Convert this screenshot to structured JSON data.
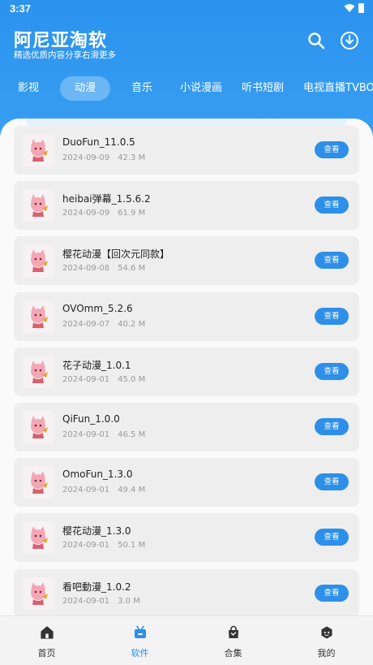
{
  "status_bar": {
    "time": "3:37"
  },
  "header": {
    "title": "阿尼亚淘软",
    "subtitle": "精选优质内容分享右滑更多"
  },
  "tabs": [
    {
      "label": "影视",
      "active": false
    },
    {
      "label": "动漫",
      "active": true
    },
    {
      "label": "音乐",
      "active": false
    },
    {
      "label": "小说漫画",
      "active": false
    },
    {
      "label": "听书短剧",
      "active": false
    },
    {
      "label": "电视直播TVBOX",
      "active": false
    }
  ],
  "items": [
    {
      "name": "DuoFun_11.0.5",
      "date": "2024-09-09",
      "size": "42.3 M",
      "action": "查看"
    },
    {
      "name": "heibai弹幕_1.5.6.2",
      "date": "2024-09-09",
      "size": "61.9 M",
      "action": "查看"
    },
    {
      "name": "樱花动漫【回次元同款】",
      "date": "2024-09-08",
      "size": "54.6 M",
      "action": "查看"
    },
    {
      "name": "OVOmm_5.2.6",
      "date": "2024-09-07",
      "size": "40.2 M",
      "action": "查看"
    },
    {
      "name": "花子动漫_1.0.1",
      "date": "2024-09-01",
      "size": "45.0 M",
      "action": "查看"
    },
    {
      "name": "QiFun_1.0.0",
      "date": "2024-09-01",
      "size": "46.5 M",
      "action": "查看"
    },
    {
      "name": "OmoFun_1.3.0",
      "date": "2024-09-01",
      "size": "49.4 M",
      "action": "查看"
    },
    {
      "name": "樱花动漫_1.3.0",
      "date": "2024-09-01",
      "size": "50.1 M",
      "action": "查看"
    },
    {
      "name": "看吧動漫_1.0.2",
      "date": "2024-09-01",
      "size": "3.0 M",
      "action": "查看"
    }
  ],
  "bottom_nav": [
    {
      "label": "首页",
      "icon": "home-icon",
      "active": false
    },
    {
      "label": "软件",
      "icon": "apps-icon",
      "active": true
    },
    {
      "label": "合集",
      "icon": "bag-icon",
      "active": false
    },
    {
      "label": "我的",
      "icon": "profile-icon",
      "active": false
    }
  ],
  "colors": {
    "primary": "#2d8fe8",
    "header_bg": "#2f97ef",
    "card_bg": "#eeeeee"
  }
}
